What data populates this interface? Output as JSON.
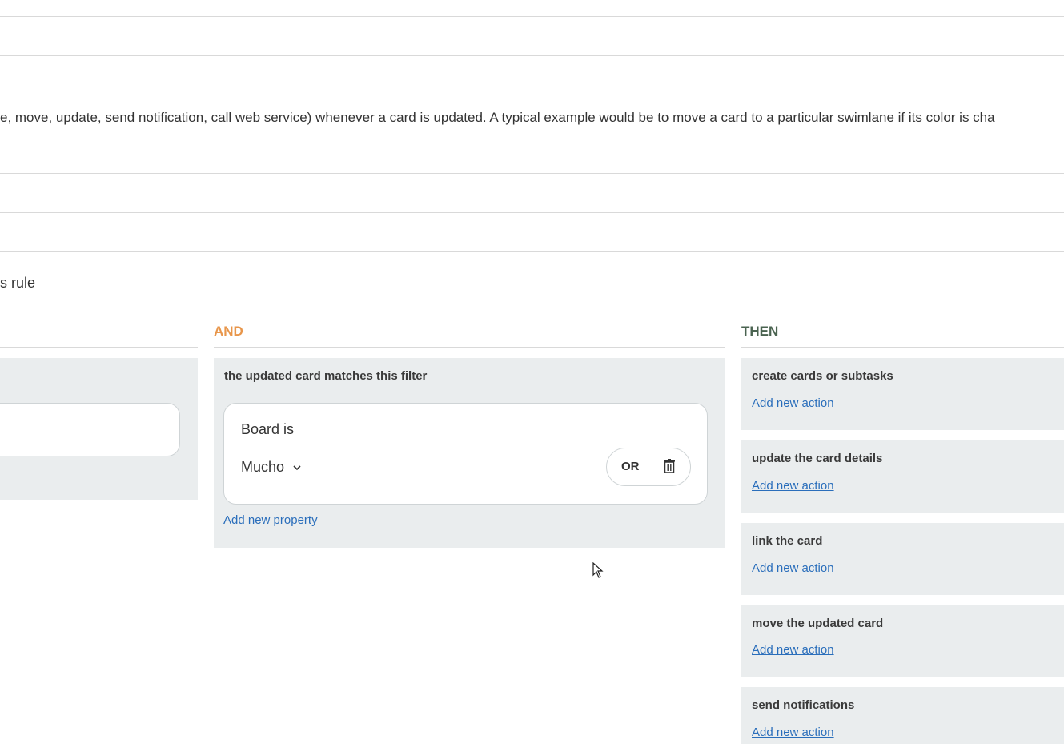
{
  "description": "e, move, update, send notification, call web service) whenever a card is updated. A typical example would be to move a card to a particular swimlane if its color is cha",
  "rule_link": "s rule",
  "columns": {
    "and_label": "AND",
    "then_label": "THEN"
  },
  "colors": {
    "and": "#e8964b",
    "then": "#4a6350",
    "link": "#2a6ebb",
    "panel": "#eaedee"
  },
  "filter": {
    "title": "the updated card matches this filter",
    "property_label": "Board is",
    "selected_value": "Mucho",
    "or_label": "OR",
    "add_property": "Add new property"
  },
  "actions": [
    {
      "title": "create cards or subtasks",
      "link": "Add new action"
    },
    {
      "title": "update the card details",
      "link": "Add new action"
    },
    {
      "title": "link the card",
      "link": "Add new action"
    },
    {
      "title": "move the updated card",
      "link": "Add new action"
    },
    {
      "title": "send notifications",
      "link": "Add new action"
    }
  ],
  "icons": [
    "chevron-down-icon",
    "trash-icon",
    "mouse-cursor-icon"
  ]
}
